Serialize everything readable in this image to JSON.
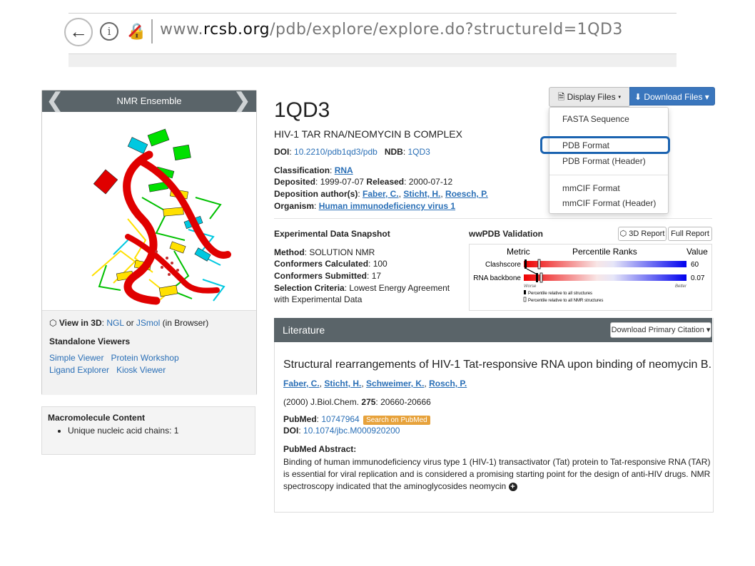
{
  "browser": {
    "url_host_prefix": "www.",
    "url_host_bold": "rcsb.org",
    "url_path": "/pdb/explore/explore.do?structureId=1QD3"
  },
  "ensemble": {
    "title": "NMR Ensemble",
    "view3d_label": "View in 3D",
    "view3d_ngl": "NGL",
    "view3d_or": "or",
    "view3d_jsmol": "JSmol",
    "view3d_suffix": "(in Browser)",
    "standalone_title": "Standalone Viewers",
    "viewers": [
      "Simple Viewer",
      "Protein Workshop",
      "Ligand Explorer",
      "Kiosk Viewer"
    ]
  },
  "macromolecule": {
    "title": "Macromolecule Content",
    "items": [
      "Unique nucleic acid chains: 1"
    ]
  },
  "structure": {
    "id": "1QD3",
    "title": "HIV-1 TAR RNA/NEOMYCIN B COMPLEX",
    "doi_label": "DOI",
    "doi": "10.2210/pdb1qd3/pdb",
    "ndb_label": "NDB",
    "ndb": "1QD3",
    "classification_label": "Classification",
    "classification": "RNA",
    "deposited_label": "Deposited",
    "deposited": "1999-07-07",
    "released_label": "Released",
    "released": "2000-07-12",
    "authors_label": "Deposition author(s)",
    "authors": [
      "Faber, C.",
      "Sticht, H.",
      "Roesch, P."
    ],
    "organism_label": "Organism",
    "organism": "Human immunodeficiency virus 1"
  },
  "toolbar": {
    "display_files": "Display Files",
    "download_files": "Download Files"
  },
  "display_menu": {
    "items": [
      "FASTA Sequence",
      "PDB Format",
      "PDB Format (Header)",
      "mmCIF Format",
      "mmCIF Format (Header)"
    ]
  },
  "experimental": {
    "title": "Experimental Data Snapshot",
    "method_label": "Method",
    "method": "SOLUTION NMR",
    "calc_label": "Conformers Calculated",
    "calc": "100",
    "submitted_label": "Conformers Submitted",
    "submitted": "17",
    "criteria_label": "Selection Criteria",
    "criteria_1": "Lowest Energy Agreement",
    "criteria_2": "with Experimental Data"
  },
  "validation": {
    "title": "wwPDB Validation",
    "report_3d": "3D Report",
    "full_report": "Full Report",
    "col_metric": "Metric",
    "col_ranks": "Percentile Ranks",
    "col_value": "Value",
    "rows": [
      {
        "metric": "Clashscore",
        "value": "60"
      },
      {
        "metric": "RNA backbone",
        "value": "0.07"
      }
    ],
    "worse": "Worse",
    "better": "Better",
    "legend_all": "Percentile relative to all structures",
    "legend_nmr": "Percentile relative to all NMR structures"
  },
  "literature": {
    "title": "Literature",
    "download_citation": "Download Primary Citation",
    "article_title": "Structural rearrangements of HIV-1 Tat-responsive RNA upon binding of neomycin B.",
    "authors": [
      "Faber, C.",
      "Sticht, H.",
      "Schweimer, K.",
      "Rosch, P."
    ],
    "citation_prefix": "(2000) J.Biol.Chem.",
    "citation_volume": "275",
    "citation_pages": ": 20660-20666",
    "pubmed_label": "PubMed",
    "pubmed_id": "10747964",
    "pubmed_search": "Search on PubMed",
    "doi_label": "DOI",
    "doi": "10.1074/jbc.M000920200",
    "abstract_label": "PubMed Abstract",
    "abstract": "Binding of human immunodeficiency virus type 1 (HIV-1) transactivator (Tat) protein to Tat-responsive RNA (TAR) is essential for viral replication and is considered a promising starting point for the design of anti-HIV drugs. NMR spectroscopy indicated that the aminoglycosides neomycin"
  }
}
